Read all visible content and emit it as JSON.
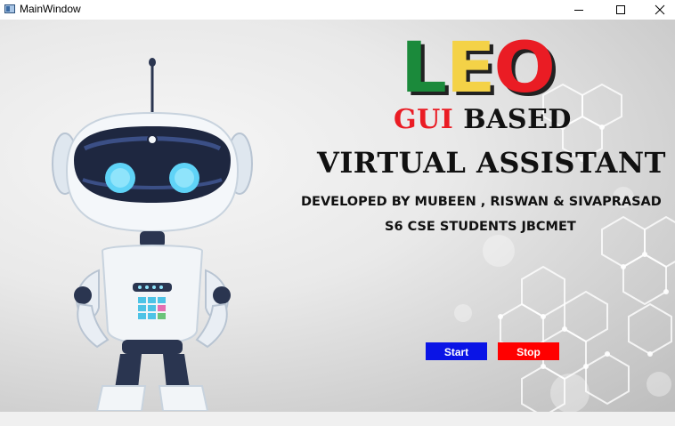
{
  "window": {
    "title": "MainWindow"
  },
  "brand": {
    "letters": [
      {
        "char": "L",
        "color": "#1b8a3b"
      },
      {
        "char": "E",
        "color": "#f4d247"
      },
      {
        "char": "O",
        "color": "#ea1c24"
      }
    ]
  },
  "heading": {
    "line1_red": "GUI",
    "line1_rest": " BASED",
    "line2": "VIRTUAL ASSISTANT"
  },
  "credits": {
    "developers": "DEVELOPED BY  MUBEEN ,  RISWAN  &  SIVAPRASAD",
    "students": "S6 CSE STUDENTS JBCMET"
  },
  "buttons": {
    "start": "Start",
    "stop": "Stop"
  },
  "icons": {
    "app": "window-app-icon",
    "minimize": "minimize-icon",
    "maximize": "maximize-icon",
    "close": "close-icon"
  }
}
